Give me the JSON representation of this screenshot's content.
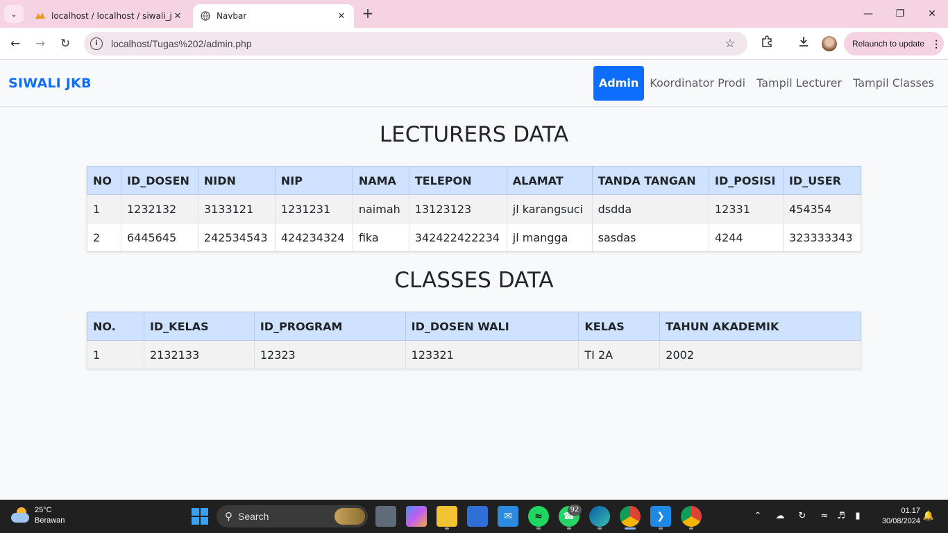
{
  "browser": {
    "tabs": [
      {
        "title": "localhost / localhost / siwali_jkb",
        "active": false
      },
      {
        "title": "Navbar",
        "active": true
      }
    ],
    "url": "localhost/Tugas%202/admin.php",
    "relaunch_label": "Relaunch to update"
  },
  "navbar": {
    "brand": "SIWALI JKB",
    "links": [
      {
        "label": "Admin",
        "active": true
      },
      {
        "label": "Koordinator Prodi",
        "active": false
      },
      {
        "label": "Tampil Lecturer",
        "active": false
      },
      {
        "label": "Tampil Classes",
        "active": false
      }
    ]
  },
  "lecturers": {
    "title": "LECTURERS DATA",
    "headers": [
      "NO",
      "ID_DOSEN",
      "NIDN",
      "NIP",
      "NAMA",
      "TELEPON",
      "ALAMAT",
      "TANDA TANGAN",
      "ID_POSISI",
      "ID_USER"
    ],
    "rows": [
      [
        "1",
        "1232132",
        "3133121",
        "1231231",
        "naimah",
        "13123123",
        "jl karangsuci",
        "dsdda",
        "12331",
        "454354"
      ],
      [
        "2",
        "6445645",
        "242534543",
        "424234324",
        "fika",
        "342422422234",
        "jl mangga",
        "sasdas",
        "4244",
        "323333343"
      ]
    ]
  },
  "classes": {
    "title": "CLASSES DATA",
    "headers": [
      "NO.",
      "ID_KELAS",
      "ID_PROGRAM",
      "ID_DOSEN WALI",
      "KELAS",
      "TAHUN AKADEMIK"
    ],
    "rows": [
      [
        "1",
        "2132133",
        "12323",
        "123321",
        "TI 2A",
        "2002"
      ]
    ]
  },
  "taskbar": {
    "weather_temp": "25°C",
    "weather_desc": "Berawan",
    "search_label": "Search",
    "whatsapp_badge": "92",
    "time": "01.17",
    "date": "30/08/2024"
  },
  "colors": {
    "primary": "#0d6efd",
    "table_header": "#cfe2ff",
    "tab_strip": "#f6d3e3"
  }
}
